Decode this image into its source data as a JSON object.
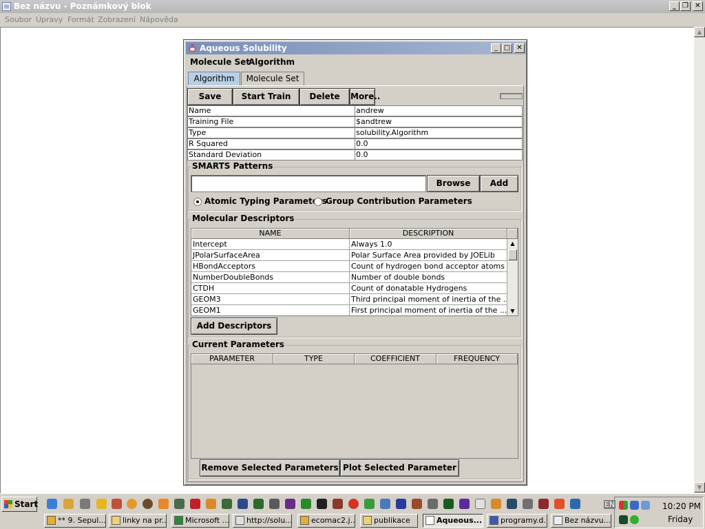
{
  "notepad": {
    "title": "Bez názvu - Poznámkový blok",
    "menu": [
      "Soubor",
      "Úpravy",
      "Formát",
      "Zobrazení",
      "Nápověda"
    ]
  },
  "app": {
    "title": "Aqueous Solubility",
    "menu": [
      "Molecule Set",
      "Algorithm"
    ],
    "tabs": [
      "Algorithm",
      "Molecule Set"
    ],
    "selected_tab": "Algorithm",
    "toolbar": {
      "save": "Save",
      "start_train": "Start Train",
      "delete": "Delete",
      "more": "More.."
    },
    "properties": [
      {
        "key": "Name",
        "value": "andrew"
      },
      {
        "key": "Training File",
        "value": "$andtrew"
      },
      {
        "key": "Type",
        "value": "solubility.Algorithm"
      },
      {
        "key": "R Squared",
        "value": "0.0"
      },
      {
        "key": "Standard Deviation",
        "value": "0.0"
      }
    ],
    "smarts": {
      "title": "SMARTS Patterns",
      "input_value": "",
      "browse": "Browse",
      "add": "Add",
      "radio_atomic": "Atomic Typing Parameters",
      "radio_group": "Group Contribution Parameters",
      "selected": "Atomic Typing Parameters"
    },
    "descriptors": {
      "title": "Molecular Descriptors",
      "columns": [
        "NAME",
        "DESCRIPTION"
      ],
      "rows": [
        [
          "Intercept",
          "Always 1.0"
        ],
        [
          "JPolarSurfaceArea",
          "Polar Surface Area provided by JOELib"
        ],
        [
          "HBondAcceptors",
          "Count of hydrogen bond acceptor atoms"
        ],
        [
          "NumberDoubleBonds",
          "Number of double bonds"
        ],
        [
          "CTDH",
          "Count of donatable Hydrogens"
        ],
        [
          "GEOM3",
          "Third principal moment of inertia of the ..."
        ],
        [
          "GEOM1",
          "First principal moment of inertia of the ..."
        ]
      ],
      "add_button": "Add Descriptors"
    },
    "parameters": {
      "title": "Current Parameters",
      "columns": [
        "PARAMETER",
        "TYPE",
        "COEFFICIENT",
        "FREQUENCY"
      ],
      "remove_button": "Remove Selected Parameters",
      "plot_button": "Plot Selected Parameter"
    }
  },
  "taskbar": {
    "start": "Start",
    "tasks": [
      "** 9. Sepul...",
      "linky na pr...",
      "Microsoft ...",
      "http://solu...",
      "ecomac2.j...",
      "publikace",
      "Aqueous...",
      "programy.d...",
      "Bez názvu..."
    ],
    "active_task": "Aqueous...",
    "lang": "EN",
    "time": "10:20 PM",
    "day": "Friday"
  }
}
